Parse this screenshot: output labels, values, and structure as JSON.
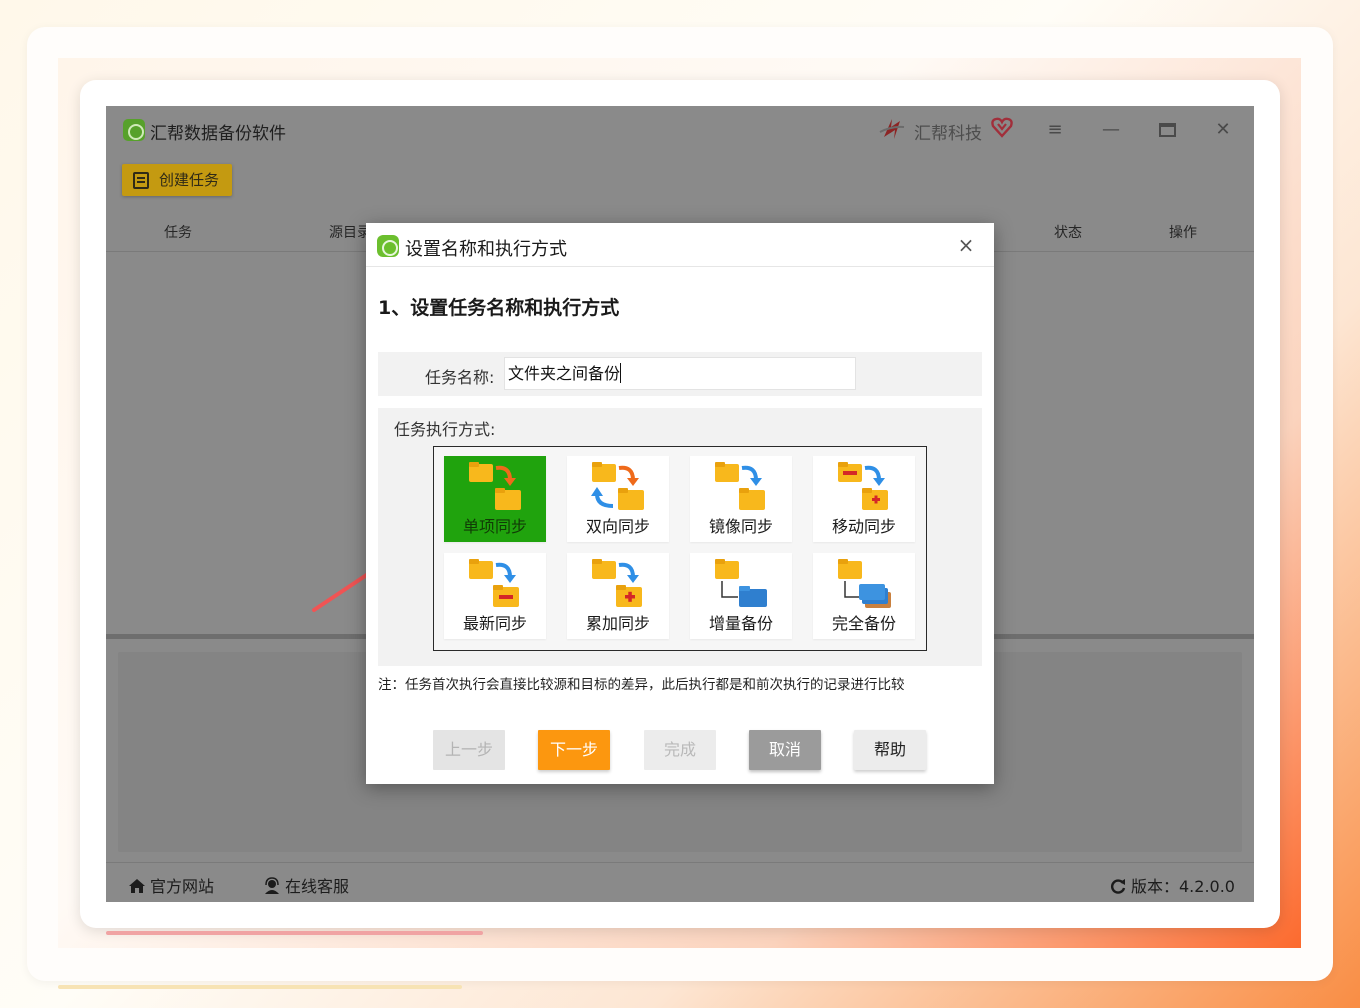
{
  "app": {
    "title": "汇帮数据备份软件",
    "brand": "汇帮科技",
    "create_task_label": "创建任务",
    "columns": [
      "任务",
      "源目录",
      "状态",
      "操作"
    ],
    "footer": {
      "website": "官方网站",
      "support": "在线客服",
      "version": "版本：4.2.0.0"
    }
  },
  "dialog": {
    "title": "设置名称和执行方式",
    "step_heading": "1、设置任务名称和执行方式",
    "task_name_label": "任务名称:",
    "task_name_value": "文件夹之间备份",
    "mode_label": "任务执行方式:",
    "modes": [
      {
        "label": "单项同步",
        "selected": true,
        "icon": "one-way-sync-icon"
      },
      {
        "label": "双向同步",
        "selected": false,
        "icon": "two-way-sync-icon"
      },
      {
        "label": "镜像同步",
        "selected": false,
        "icon": "mirror-sync-icon"
      },
      {
        "label": "移动同步",
        "selected": false,
        "icon": "move-sync-icon"
      },
      {
        "label": "最新同步",
        "selected": false,
        "icon": "latest-sync-icon"
      },
      {
        "label": "累加同步",
        "selected": false,
        "icon": "cumulative-sync-icon"
      },
      {
        "label": "增量备份",
        "selected": false,
        "icon": "incremental-backup-icon"
      },
      {
        "label": "完全备份",
        "selected": false,
        "icon": "full-backup-icon"
      }
    ],
    "note": "注：任务首次执行会直接比较源和目标的差异，此后执行都是和前次执行的记录进行比较",
    "buttons": {
      "prev": "上一步",
      "next": "下一步",
      "done": "完成",
      "cancel": "取消",
      "help": "帮助"
    }
  },
  "colors": {
    "selected_mode": "#20a30d",
    "next_button": "#fc970f",
    "folder": "#f8b81c",
    "annotation_arrow": "#f05454"
  }
}
